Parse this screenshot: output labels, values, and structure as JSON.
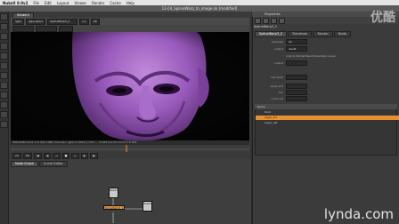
{
  "menubar": {
    "app_name": "NukeX 8.0v2",
    "items": [
      "File",
      "Edit",
      "Layout",
      "Viewer",
      "Render",
      "Cache",
      "Help"
    ]
  },
  "window": {
    "title": "12-04_SplineWarp_to_image.nk [modified]"
  },
  "viewer": {
    "tab_label": "Viewer1",
    "toolbar": {
      "channels": "rgba",
      "channel_alpha": "rgba.alpha",
      "input": "SplineWarp3_2",
      "zoom": "1:1",
      "mode": "2D"
    },
    "status": "960x1080 bbox: 0 0 960 1080 channels: rgba x=2023 y=517  ...  H:333 S:0.53 V:0.07 L:0.028",
    "frame": "56",
    "fps": "24"
  },
  "node_graph": {
    "tabs": [
      "Node Graph",
      "Curve Editor"
    ],
    "nodes": [
      {
        "label": "Read1",
        "sub": "...",
        "color": "#c9c9c9"
      },
      {
        "label": "SplineWarp3_2",
        "sub": "",
        "color": "#e7a04b"
      },
      {
        "label": "Read2",
        "sub": "...",
        "color": "#c9c9c9"
      }
    ]
  },
  "properties": {
    "panel_title": "Properties",
    "node_name": "SplineWarp3_2",
    "tabs": [
      "SplineWarp3_2",
      "Transform",
      "Render",
      "Node"
    ],
    "fields": [
      {
        "label": "channels",
        "value": "all"
      },
      {
        "label": "output",
        "value": "result"
      },
      {
        "label": "",
        "value": "crop to format   blend boundary curve"
      },
      {
        "label": "output",
        "value": ""
      },
      {
        "label": "root warp",
        "value": ""
      },
      {
        "label": "warp amt",
        "value": ""
      },
      {
        "label": "mix",
        "value": ""
      },
      {
        "label": "curve res",
        "value": ""
      }
    ],
    "curves": {
      "header": "Name",
      "rows": [
        {
          "name": "Root",
          "selected": false
        },
        {
          "name": "Layer_src",
          "selected": true
        },
        {
          "name": "Layer_dst",
          "selected": false
        }
      ]
    }
  },
  "watermarks": {
    "top_right": "优酷",
    "bottom_right": "lynda.com"
  },
  "colors": {
    "node_orange": "#e7a04b",
    "selection_orange": "#e8902e",
    "face_purple": "#8a4aa8"
  }
}
